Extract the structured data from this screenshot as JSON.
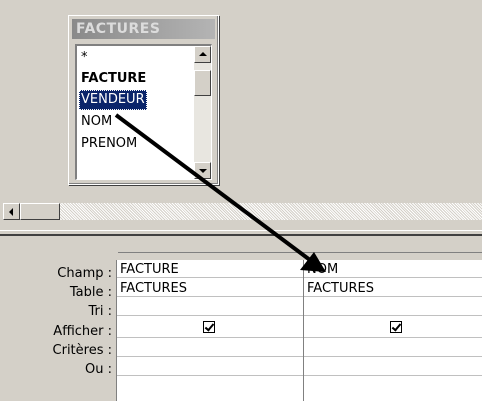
{
  "field_list": {
    "title": "FACTURES",
    "items": [
      {
        "label": "*",
        "bold": false,
        "selected": false
      },
      {
        "label": "FACTURE",
        "bold": true,
        "selected": false
      },
      {
        "label": "VENDEUR",
        "bold": false,
        "selected": true
      },
      {
        "label": "NOM",
        "bold": false,
        "selected": false
      },
      {
        "label": "PRENOM",
        "bold": false,
        "selected": false
      }
    ]
  },
  "grid": {
    "row_labels": {
      "champ": "Champ :",
      "table": "Table :",
      "tri": "Tri :",
      "afficher": "Afficher :",
      "criteres": "Critères :",
      "ou": "Ou :"
    },
    "columns": [
      {
        "champ": "FACTURE",
        "table": "FACTURES",
        "afficher": true
      },
      {
        "champ": "NOM",
        "table": "FACTURES",
        "afficher": true
      }
    ]
  },
  "icons": {
    "scroll_up": "triangle-up-icon",
    "scroll_down": "triangle-down-icon",
    "scroll_left": "triangle-left-icon",
    "drag_arrow": "arrow-icon"
  },
  "colors": {
    "selection": "#0a246a",
    "title_gradient_start": "#8a8a8a",
    "title_gradient_end": "#b4b4b4",
    "window_bg": "#d4d0c8"
  }
}
